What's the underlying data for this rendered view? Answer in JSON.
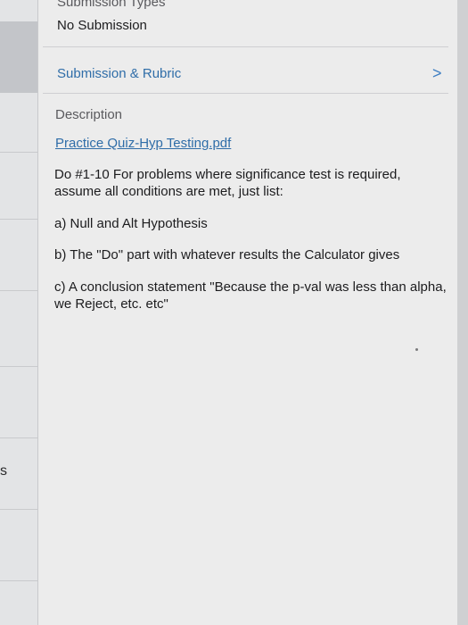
{
  "left_pane": {
    "partial_text": "s"
  },
  "submission": {
    "types_label": "Submission Types",
    "types_value": "No Submission"
  },
  "rubric": {
    "label": "Submission & Rubric",
    "chevron_icon": "chevron-right-icon"
  },
  "description": {
    "label": "Description",
    "attachment": "Practice Quiz-Hyp Testing.pdf",
    "paragraphs": [
      "Do #1-10 For problems where significance test is required, assume all conditions are met, just list:",
      "a) Null and Alt Hypothesis",
      "b) The \"Do\" part with whatever results the Calculator gives",
      "c) A conclusion statement \"Because the p-val was less than alpha, we Reject, etc. etc\""
    ]
  },
  "colors": {
    "link": "#2f6da8",
    "chevron": "#3c7dc2",
    "text": "#1c1c1e",
    "secondary_text": "#5a5a5e",
    "background": "#ececec"
  }
}
